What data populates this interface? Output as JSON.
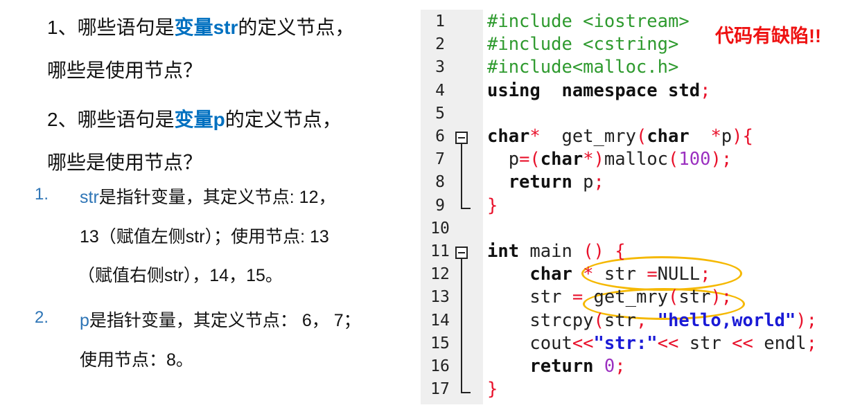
{
  "questions": [
    {
      "pre": "1、哪些语句是",
      "var": "变量str",
      "post": "的定义节点，",
      "line2": "哪些是使用节点？"
    },
    {
      "pre": "2、哪些语句是",
      "var": "变量p",
      "post": "的定义节点，",
      "line2": "哪些是使用节点？"
    }
  ],
  "answers": [
    {
      "num": "1.",
      "lines": [
        [
          "str",
          "是指针变量，其定义节点: 12，"
        ],
        [
          "",
          "13（赋值左侧str）；使用节点: 13"
        ],
        [
          "",
          "（赋值右侧str），14，15。"
        ]
      ]
    },
    {
      "num": "2.",
      "lines": [
        [
          "p",
          "是指针变量，其定义节点： 6， 7；"
        ],
        [
          "",
          "使用节点：8。"
        ]
      ]
    }
  ],
  "defect_note": "代码有缺陷!!",
  "colors": {
    "highlight": "#0070c0",
    "defect": "#ee1111",
    "ellipse": "#f5b800",
    "preprocessor": "#2e9a2e",
    "operator": "#e8102a",
    "string": "#1a1ad6",
    "number": "#9b30c0"
  },
  "code": [
    [
      [
        "#include <iostream>",
        "pp"
      ]
    ],
    [
      [
        "#include <cstring>",
        "pp"
      ]
    ],
    [
      [
        "#include<malloc.h>",
        "pp"
      ]
    ],
    [
      [
        "using",
        "kw"
      ],
      [
        "  namespace std",
        "kw"
      ],
      [
        ";",
        "op"
      ]
    ],
    [],
    [
      [
        "char",
        "kw"
      ],
      [
        "*",
        "op"
      ],
      [
        "  get_mry",
        "id"
      ],
      [
        "(",
        "op"
      ],
      [
        "char",
        "kw"
      ],
      [
        "  *",
        "op"
      ],
      [
        "p",
        "id"
      ],
      [
        "){",
        "op"
      ]
    ],
    [
      [
        "  p",
        "id"
      ],
      [
        "=(",
        "op"
      ],
      [
        "char",
        "kw"
      ],
      [
        "*",
        "op"
      ],
      [
        ")",
        "op"
      ],
      [
        "malloc",
        "id"
      ],
      [
        "(",
        "op"
      ],
      [
        "100",
        "num"
      ],
      [
        ");",
        "op"
      ]
    ],
    [
      [
        "  return",
        "kw"
      ],
      [
        " p",
        "id"
      ],
      [
        ";",
        "op"
      ]
    ],
    [
      [
        "}",
        "op"
      ]
    ],
    [],
    [
      [
        "int",
        "kw"
      ],
      [
        " main ",
        "id"
      ],
      [
        "() {",
        "op"
      ]
    ],
    [
      [
        "    char",
        "kw"
      ],
      [
        " * ",
        "op"
      ],
      [
        "str ",
        "id"
      ],
      [
        "=",
        "op"
      ],
      [
        "NULL",
        "id"
      ],
      [
        ";",
        "op"
      ]
    ],
    [
      [
        "    str ",
        "id"
      ],
      [
        "= ",
        "op"
      ],
      [
        "get_mry",
        "id"
      ],
      [
        "(",
        "op"
      ],
      [
        "str",
        "id"
      ],
      [
        ");",
        "op"
      ]
    ],
    [
      [
        "    strcpy",
        "id"
      ],
      [
        "(",
        "op"
      ],
      [
        "str",
        "id"
      ],
      [
        ", ",
        "op"
      ],
      [
        "\"hello,world\"",
        "str"
      ],
      [
        ");",
        "op"
      ]
    ],
    [
      [
        "    cout",
        "id"
      ],
      [
        "<<",
        "op"
      ],
      [
        "\"str:\"",
        "str"
      ],
      [
        "<<",
        "op"
      ],
      [
        " str ",
        "id"
      ],
      [
        "<<",
        "op"
      ],
      [
        " endl",
        "id"
      ],
      [
        ";",
        "op"
      ]
    ],
    [
      [
        "    return",
        "kw"
      ],
      [
        " 0",
        "num"
      ],
      [
        ";",
        "op"
      ]
    ],
    [
      [
        "}",
        "op"
      ]
    ]
  ]
}
